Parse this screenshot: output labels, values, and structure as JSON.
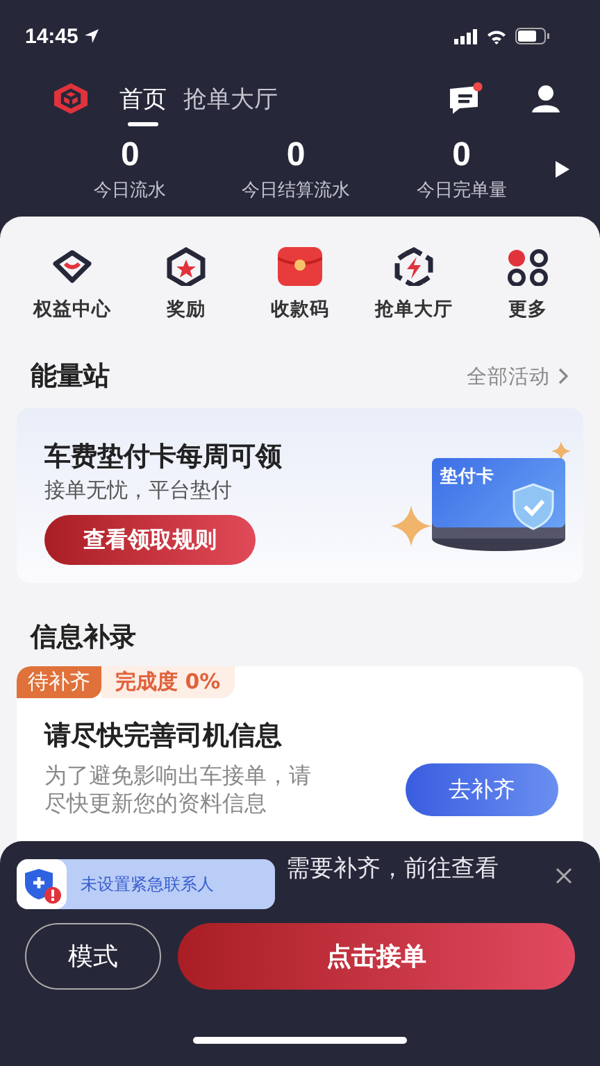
{
  "status_bar": {
    "time": "14:45"
  },
  "nav": {
    "tabs": [
      {
        "label": "首页",
        "selected": true
      },
      {
        "label": "抢单大厅",
        "selected": false
      }
    ],
    "message_badge": true
  },
  "stats": [
    {
      "value": "0",
      "label": "今日流水"
    },
    {
      "value": "0",
      "label": "今日结算流水"
    },
    {
      "value": "0",
      "label": "今日完单量"
    }
  ],
  "shortcuts": [
    {
      "label": "权益中心",
      "kind": "gem"
    },
    {
      "label": "奖励",
      "kind": "star"
    },
    {
      "label": "收款码",
      "kind": "envelope"
    },
    {
      "label": "抢单大厅",
      "kind": "bolt"
    },
    {
      "label": "更多",
      "kind": "grid"
    }
  ],
  "energy_station": {
    "title": "能量站",
    "link": "全部活动"
  },
  "promo": {
    "title": "车费垫付卡每周可领",
    "subtitle": "接单无忧，平台垫付",
    "button": "查看领取规则",
    "card_label": "垫付卡"
  },
  "info": {
    "title": "信息补录",
    "status_tag": "待补齐",
    "progress": "完成度 0%",
    "heading": "请尽快完善司机信息",
    "description": "为了避免影响出车接单，请尽快更新您的资料信息",
    "button": "去补齐"
  },
  "notice": {
    "text": "需要补齐，前往查看",
    "toast": "未设置紧急联系人"
  },
  "actions": {
    "mode_button": "模式",
    "accept_button": "点击接单"
  }
}
